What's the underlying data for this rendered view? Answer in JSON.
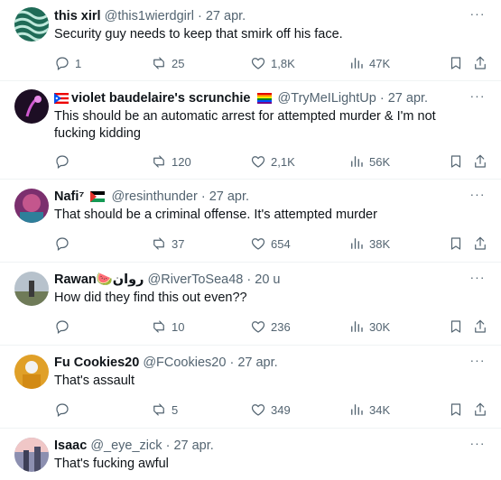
{
  "tweets": [
    {
      "name": "this xirl",
      "handle": "@this1wierdgirl",
      "time": "27 apr.",
      "text": "Security guy needs to keep that smirk off his face.",
      "replies": "1",
      "retweets": "25",
      "likes": "1,8K",
      "views": "47K",
      "avatar_color": "#3a8a6a"
    },
    {
      "name": "violet baudelaire's scrunchie",
      "name_prefix_flag": "puerto-rico-flag-icon",
      "name_suffix_flag": "rainbow-flag-icon",
      "handle": "@TryMeILightUp",
      "time": "27 apr.",
      "text": "This should be an automatic arrest for attempted murder & I'm not fucking kidding",
      "replies": "",
      "retweets": "120",
      "likes": "2,1K",
      "views": "56K",
      "avatar_color": "#2b1230"
    },
    {
      "name": "Nafi⁷",
      "name_suffix_flag": "palestine-flag-icon",
      "handle": "@resinthunder",
      "time": "27 apr.",
      "text": "That should be a criminal offense. It's attempted murder",
      "replies": "",
      "retweets": "37",
      "likes": "654",
      "views": "38K",
      "avatar_color": "#8a3f7a"
    },
    {
      "name": "Rawan🍉روان",
      "handle": "@RiverToSea48",
      "time": "20 u",
      "text": "How did they find this out even??",
      "replies": "",
      "retweets": "10",
      "likes": "236",
      "views": "30K",
      "avatar_color": "#9aa7b5"
    },
    {
      "name": "Fu Cookies20",
      "handle": "@FCookies20",
      "time": "27 apr.",
      "text": "That's assault",
      "replies": "",
      "retweets": "5",
      "likes": "349",
      "views": "34K",
      "avatar_color": "#c9811a"
    },
    {
      "name": "Isaac",
      "handle": "@_eye_zick",
      "time": "27 apr.",
      "text": "That's fucking awful",
      "replies": "",
      "retweets": "",
      "likes": "",
      "views": "",
      "avatar_color": "#6b6f8a"
    }
  ],
  "separator": "·",
  "more_glyph": "···",
  "colors": {
    "muted": "#536471",
    "text": "#0f1419",
    "divider": "#eff3f4"
  }
}
